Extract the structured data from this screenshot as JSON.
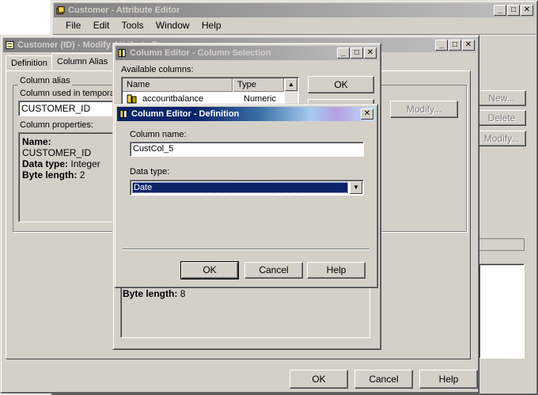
{
  "attribute_editor": {
    "title": "Customer - Attribute Editor",
    "menu": [
      "File",
      "Edit",
      "Tools",
      "Window",
      "Help"
    ],
    "right_buttons": {
      "new": "New...",
      "delete": "Delete",
      "modify": "Modify..."
    },
    "footer": {
      "ok": "OK",
      "cancel": "Cancel",
      "help": "Help"
    }
  },
  "modify_form": {
    "title": "Customer (ID) - Modify Attribute Form",
    "tabs": [
      "Definition",
      "Column Alias"
    ],
    "group_label": "Column alias",
    "column_used_label": "Column used in temporary",
    "column_value": "CUSTOMER_ID",
    "properties_label": "Column properties:",
    "properties": [
      {
        "key": "Name:",
        "value": "CUSTOMER_ID"
      },
      {
        "key": "Data type:",
        "value": "Integer"
      },
      {
        "key": "Byte length:",
        "value": "2"
      }
    ],
    "modify_button": "Modify..."
  },
  "column_selection": {
    "title": "Column Editor - Column Selection",
    "available_label": "Available columns:",
    "columns_headers": [
      "Name",
      "Type"
    ],
    "rows": [
      {
        "name": "accountbalance",
        "type": "Numeric"
      }
    ],
    "ok": "OK",
    "byte_length_key": "Byte length:",
    "byte_length_value": "8"
  },
  "definition_dialog": {
    "title": "Column Editor - Definition",
    "column_name_label": "Column name:",
    "column_name_value": "CustCol_5",
    "data_type_label": "Data type:",
    "data_type_value": "Date",
    "ok": "OK",
    "cancel": "Cancel",
    "help": "Help"
  }
}
